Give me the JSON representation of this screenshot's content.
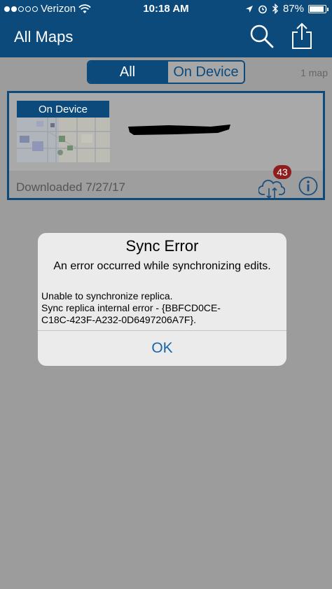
{
  "status_bar": {
    "carrier": "Verizon",
    "time": "10:18 AM",
    "battery": "87%",
    "battery_level": 0.87,
    "signal_bars": 2,
    "icons": [
      "wifi-icon",
      "location-arrow-icon",
      "alarm-icon",
      "bluetooth-icon",
      "battery-icon"
    ]
  },
  "navbar": {
    "title": "All Maps",
    "icons": [
      "search-icon",
      "share-icon"
    ]
  },
  "filter": {
    "options": [
      "All",
      "On Device"
    ],
    "selected": "All",
    "count": "1 map"
  },
  "map_card": {
    "badge": "On Device",
    "downloaded": "Downloaded 7/27/17",
    "pending_edits": "43",
    "icons": [
      "cloud-sync-icon",
      "info-icon"
    ]
  },
  "dialog": {
    "title": "Sync Error",
    "message": "An error occurred while synchronizing edits.",
    "detail_line1": "Unable to synchronize replica.",
    "detail_line2": "Sync replica internal error - {BBFCD0CE-",
    "detail_line3": "C18C-423F-A232-0D6497206A7F}.",
    "ok_label": "OK"
  },
  "colors": {
    "brand": "#0c4a7c",
    "overlay_background": "#9c9c9c",
    "badge_red": "#8e1d1d",
    "dialog_button": "#1866a6"
  }
}
